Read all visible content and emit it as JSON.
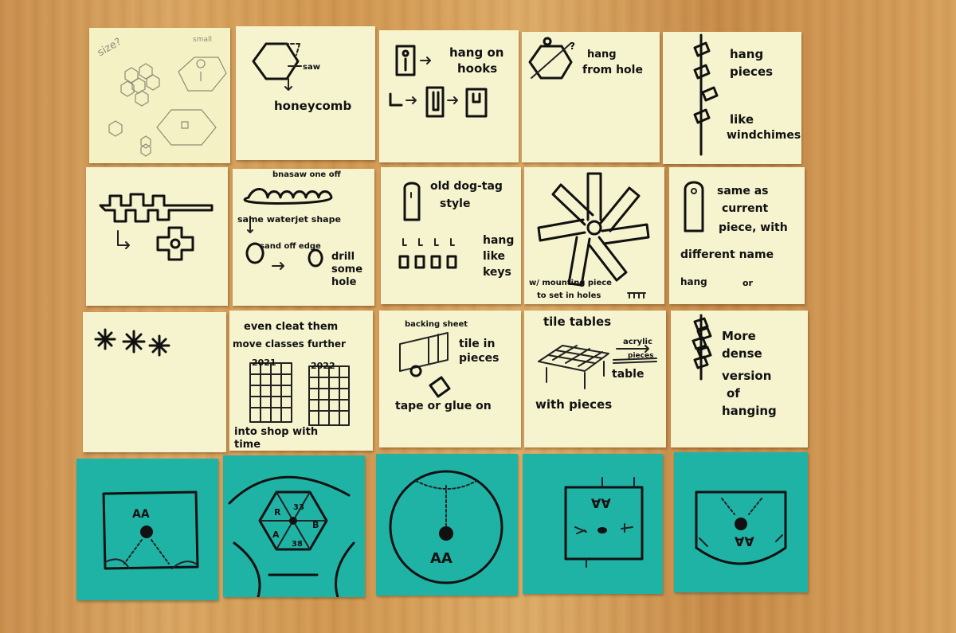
{
  "notes": [
    {
      "id": "r1c1",
      "labels": {
        "size": "size?",
        "small": "small"
      }
    },
    {
      "id": "r1c2",
      "labels": {
        "saw": "saw",
        "result": "honeycomb"
      }
    },
    {
      "id": "r1c3",
      "labels": {
        "line1": "hang on",
        "line2": "hooks"
      }
    },
    {
      "id": "r1c4",
      "labels": {
        "q": "?",
        "line1": "hang",
        "line2": "from hole"
      }
    },
    {
      "id": "r1c5",
      "labels": {
        "line1": "hang",
        "line2": "pieces",
        "line3": "like",
        "line4": "windchimes"
      }
    },
    {
      "id": "r2c1",
      "labels": {}
    },
    {
      "id": "r2c2",
      "labels": {
        "top": "bnasaw one off",
        "mid": "same waterjet shape",
        "sand": "sand off edge",
        "drill1": "drill",
        "drill2": "some",
        "drill3": "hole"
      }
    },
    {
      "id": "r2c3",
      "labels": {
        "line1": "old dog-tag",
        "line2": "style",
        "hang1": "hang",
        "hang2": "like",
        "hang3": "keys"
      }
    },
    {
      "id": "r2c4",
      "labels": {
        "line1": "w/ mounting piece",
        "line2": "to set in holes"
      }
    },
    {
      "id": "r2c5",
      "labels": {
        "line1": "same as",
        "line2": "current",
        "line3": "piece, with",
        "line4": "different name",
        "line5": "hang",
        "or": "or"
      }
    },
    {
      "id": "r3c1",
      "labels": {}
    },
    {
      "id": "r3c2",
      "labels": {
        "line1": "even  cleat them",
        "line2": "move classes further",
        "y1": "2021",
        "y2": "2022",
        "line3": "into shop with",
        "line4": "time"
      }
    },
    {
      "id": "r3c3",
      "labels": {
        "sheet": "backing sheet",
        "tile1": "tile in",
        "tile2": "pieces",
        "bottom": "tape or glue on"
      }
    },
    {
      "id": "r3c4",
      "labels": {
        "title": "tile tables",
        "acrylic": "acrylic",
        "pieces": "pieces",
        "table": "table",
        "bottom": "with pieces"
      }
    },
    {
      "id": "r3c5",
      "labels": {
        "line1": "More",
        "line2": "dense",
        "line3": "version",
        "line4": "of",
        "line5": "hanging"
      }
    },
    {
      "id": "r4c1",
      "labels": {
        "aa": "AA"
      }
    },
    {
      "id": "r4c2",
      "labels": {
        "s1": "33",
        "s2": "R",
        "s3": "B",
        "s4": "A",
        "s5": "38"
      }
    },
    {
      "id": "r4c3",
      "labels": {
        "aa": "AA"
      }
    },
    {
      "id": "r4c4",
      "labels": {
        "aa": "AA"
      }
    },
    {
      "id": "r4c5",
      "labels": {
        "aa": "AA"
      }
    }
  ]
}
